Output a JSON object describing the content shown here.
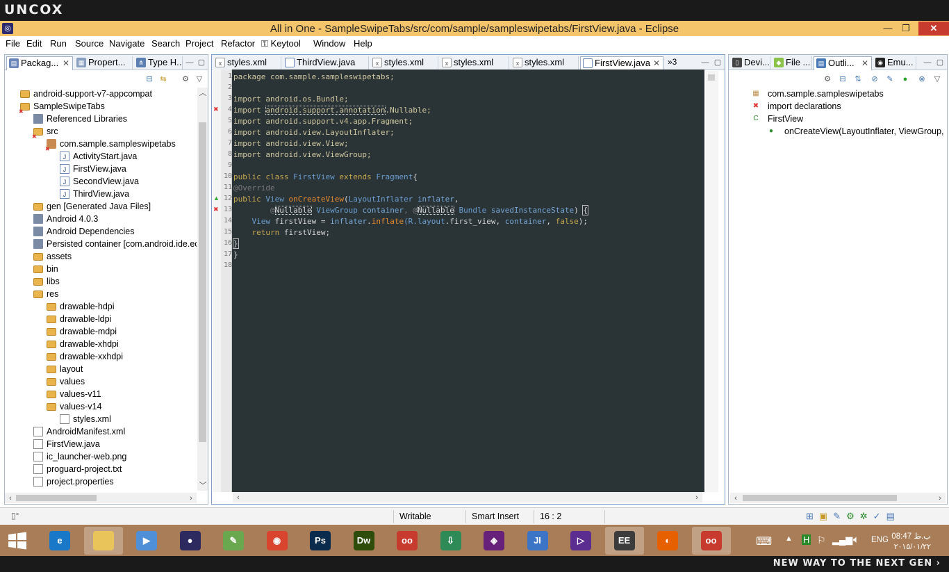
{
  "brand": {
    "logo": "UNCOX",
    "tagline": "NEW WAY TO THE NEXT GEN ›"
  },
  "window": {
    "title": "All in One - SampleSwipeTabs/src/com/sample/sampleswipetabs/FirstView.java - Eclipse",
    "min": "—",
    "max": "❐",
    "close": "✕"
  },
  "menu": [
    "File",
    "Edit",
    "Run",
    "Source",
    "Navigate",
    "Search",
    "Project",
    "Refactor",
    "Keytool",
    "Window",
    "Help"
  ],
  "left_tabs": [
    {
      "label": "Packag...",
      "icon": "package-explorer-icon",
      "active": true
    },
    {
      "label": "Propert...",
      "icon": "properties-icon"
    },
    {
      "label": "Type H...",
      "icon": "type-hierarchy-icon"
    }
  ],
  "tree": [
    {
      "label": "android-support-v7-appcompat",
      "indent": 0,
      "icon": "project"
    },
    {
      "label": "SampleSwipeTabs",
      "indent": 0,
      "icon": "project-error"
    },
    {
      "label": "Referenced Libraries",
      "indent": 1,
      "icon": "lib"
    },
    {
      "label": "src",
      "indent": 1,
      "icon": "folder-error"
    },
    {
      "label": "com.sample.sampleswipetabs",
      "indent": 2,
      "icon": "package-error"
    },
    {
      "label": "ActivityStart.java",
      "indent": 3,
      "icon": "java"
    },
    {
      "label": "FirstView.java",
      "indent": 3,
      "icon": "java"
    },
    {
      "label": "SecondView.java",
      "indent": 3,
      "icon": "java"
    },
    {
      "label": "ThirdView.java",
      "indent": 3,
      "icon": "java"
    },
    {
      "label": "gen [Generated Java Files]",
      "indent": 1,
      "icon": "folder"
    },
    {
      "label": "Android 4.0.3",
      "indent": 1,
      "icon": "lib"
    },
    {
      "label": "Android Dependencies",
      "indent": 1,
      "icon": "lib"
    },
    {
      "label": "Persisted container [com.android.ide.ecl",
      "indent": 1,
      "icon": "lib"
    },
    {
      "label": "assets",
      "indent": 1,
      "icon": "folder"
    },
    {
      "label": "bin",
      "indent": 1,
      "icon": "folder"
    },
    {
      "label": "libs",
      "indent": 1,
      "icon": "folder"
    },
    {
      "label": "res",
      "indent": 1,
      "icon": "folder"
    },
    {
      "label": "drawable-hdpi",
      "indent": 2,
      "icon": "folder"
    },
    {
      "label": "drawable-ldpi",
      "indent": 2,
      "icon": "folder"
    },
    {
      "label": "drawable-mdpi",
      "indent": 2,
      "icon": "folder"
    },
    {
      "label": "drawable-xhdpi",
      "indent": 2,
      "icon": "folder"
    },
    {
      "label": "drawable-xxhdpi",
      "indent": 2,
      "icon": "folder"
    },
    {
      "label": "layout",
      "indent": 2,
      "icon": "folder"
    },
    {
      "label": "values",
      "indent": 2,
      "icon": "folder"
    },
    {
      "label": "values-v11",
      "indent": 2,
      "icon": "folder"
    },
    {
      "label": "values-v14",
      "indent": 2,
      "icon": "folder"
    },
    {
      "label": "styles.xml",
      "indent": 3,
      "icon": "file"
    },
    {
      "label": "AndroidManifest.xml",
      "indent": 1,
      "icon": "file"
    },
    {
      "label": "FirstView.java",
      "indent": 1,
      "icon": "file"
    },
    {
      "label": "ic_launcher-web.png",
      "indent": 1,
      "icon": "image"
    },
    {
      "label": "proguard-project.txt",
      "indent": 1,
      "icon": "file"
    },
    {
      "label": "project.properties",
      "indent": 1,
      "icon": "file"
    }
  ],
  "editor_tabs": [
    {
      "label": "styles.xml"
    },
    {
      "label": "ThirdView.java"
    },
    {
      "label": "styles.xml"
    },
    {
      "label": "styles.xml"
    },
    {
      "label": "styles.xml"
    },
    {
      "label": "FirstView.java",
      "active": true
    }
  ],
  "editor_overflow": "»3",
  "code": {
    "l1": "package com.sample.sampleswipetabs;",
    "l3": "import android.os.Bundle;",
    "l4a": "import ",
    "l4b": "android.support.annotation",
    "l4c": ".Nullable;",
    "l5": "import android.support.v4.app.Fragment;",
    "l6": "import android.view.LayoutInflater;",
    "l7": "import android.view.View;",
    "l8": "import android.view.ViewGroup;",
    "l10a": "public class ",
    "l10b": "FirstView",
    "l10c": " extends ",
    "l10d": "Fragment",
    "l10e": "{",
    "l11": "@Override",
    "l12a": "public ",
    "l12b": "View ",
    "l12c": "onCreateView",
    "l12d": "(",
    "l12e": "LayoutInflater ",
    "l12f": "inflater",
    "l12g": ",",
    "l13a": "        @",
    "l13b": "Nullable",
    "l13c": " ViewGroup ",
    "l13d": "container",
    "l13e": ", @",
    "l13f": "Nullable",
    "l13g": " Bundle ",
    "l13h": "savedInstanceState",
    "l13i": ") ",
    "l13j": "{",
    "l14a": "    View ",
    "l14b": "firstView = ",
    "l14c": "inflater",
    "l14d": ".",
    "l14e": "inflate",
    "l14f": "(R.",
    "l14g": "layout",
    "l14h": ".first_view, ",
    "l14i": "container",
    "l14j": ", ",
    "l14k": "false",
    "l14l": ");",
    "l15a": "    return ",
    "l15b": "firstView;",
    "l16": "}",
    "l17": "}"
  },
  "line_numbers": [
    "1",
    "2",
    "3",
    "4",
    "5",
    "6",
    "7",
    "8",
    "9",
    "10",
    "11",
    "12",
    "13",
    "14",
    "15",
    "16",
    "17",
    "18"
  ],
  "right_tabs": [
    {
      "label": "Devi...",
      "icon": "device-icon"
    },
    {
      "label": "File ...",
      "icon": "android-icon"
    },
    {
      "label": "Outli...",
      "icon": "outline-icon",
      "active": true
    },
    {
      "label": "Emu...",
      "icon": "emulator-icon"
    }
  ],
  "outline": [
    {
      "label": "com.sample.sampleswipetabs",
      "indent": 0
    },
    {
      "label": "import declarations",
      "indent": 0
    },
    {
      "label": "FirstView",
      "indent": 0
    },
    {
      "label": "onCreateView(LayoutInflater, ViewGroup, B",
      "indent": 1
    }
  ],
  "status": {
    "writable": "Writable",
    "insert": "Smart Insert",
    "position": "16 : 2"
  },
  "taskbar": {
    "apps": [
      {
        "name": "ie-icon",
        "color": "#1a78c8",
        "glyph": "e"
      },
      {
        "name": "explorer-icon",
        "color": "#e8c45a",
        "glyph": ""
      },
      {
        "name": "media-player-icon",
        "color": "#4f8fd8",
        "glyph": "▶"
      },
      {
        "name": "eclipse-icon",
        "color": "#2c2a5e",
        "glyph": "●"
      },
      {
        "name": "notepadpp-icon",
        "color": "#6aa84f",
        "glyph": "✎"
      },
      {
        "name": "chrome-icon",
        "color": "#d9442e",
        "glyph": "◉"
      },
      {
        "name": "photoshop-icon",
        "color": "#0b2b4d",
        "glyph": "Ps"
      },
      {
        "name": "dreamweaver-icon",
        "color": "#2f4d0a",
        "glyph": "Dw"
      },
      {
        "name": "flickr-icon",
        "color": "#c73b2e",
        "glyph": "oo"
      },
      {
        "name": "globe-download-icon",
        "color": "#2e8b57",
        "glyph": "⇩"
      },
      {
        "name": "visual-studio-icon",
        "color": "#68217a",
        "glyph": "◈"
      },
      {
        "name": "jetbrains-icon",
        "color": "#3c74c6",
        "glyph": "JI"
      },
      {
        "name": "vs-blend-icon",
        "color": "#5c2d91",
        "glyph": "▷"
      },
      {
        "name": "java-ee-ide-icon",
        "color": "#3c3c3c",
        "glyph": "EE"
      },
      {
        "name": "firefox-icon",
        "color": "#e66000",
        "glyph": "◐"
      },
      {
        "name": "flickr2-icon",
        "color": "#c73b2e",
        "glyph": "oo"
      }
    ],
    "lang": "ENG",
    "time": "08:47 ب.ظ",
    "date": "۲۰۱۵/۰۱/۲۲"
  }
}
